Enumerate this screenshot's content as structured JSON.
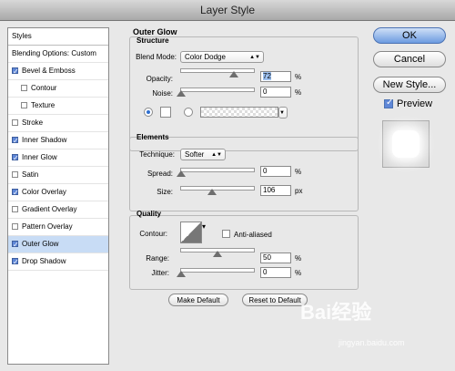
{
  "window": {
    "title": "Layer Style"
  },
  "styles_panel": {
    "header": "Styles",
    "items": [
      {
        "label": "Blending Options: Custom",
        "checkbox": false,
        "checked": false,
        "selected": false,
        "indent": 0
      },
      {
        "label": "Bevel & Emboss",
        "checkbox": true,
        "checked": true,
        "selected": false,
        "indent": 0
      },
      {
        "label": "Contour",
        "checkbox": true,
        "checked": false,
        "selected": false,
        "indent": 1
      },
      {
        "label": "Texture",
        "checkbox": true,
        "checked": false,
        "selected": false,
        "indent": 1
      },
      {
        "label": "Stroke",
        "checkbox": true,
        "checked": false,
        "selected": false,
        "indent": 0
      },
      {
        "label": "Inner Shadow",
        "checkbox": true,
        "checked": true,
        "selected": false,
        "indent": 0
      },
      {
        "label": "Inner Glow",
        "checkbox": true,
        "checked": true,
        "selected": false,
        "indent": 0
      },
      {
        "label": "Satin",
        "checkbox": true,
        "checked": false,
        "selected": false,
        "indent": 0
      },
      {
        "label": "Color Overlay",
        "checkbox": true,
        "checked": true,
        "selected": false,
        "indent": 0
      },
      {
        "label": "Gradient Overlay",
        "checkbox": true,
        "checked": false,
        "selected": false,
        "indent": 0
      },
      {
        "label": "Pattern Overlay",
        "checkbox": true,
        "checked": false,
        "selected": false,
        "indent": 0
      },
      {
        "label": "Outer Glow",
        "checkbox": true,
        "checked": true,
        "selected": true,
        "indent": 0
      },
      {
        "label": "Drop Shadow",
        "checkbox": true,
        "checked": true,
        "selected": false,
        "indent": 0
      }
    ]
  },
  "outer_glow": {
    "title": "Outer Glow",
    "structure": {
      "title": "Structure",
      "blend_mode_label": "Blend Mode:",
      "blend_mode_value": "Color Dodge",
      "opacity_label": "Opacity:",
      "opacity_value": "72",
      "opacity_fraction": 0.72,
      "noise_label": "Noise:",
      "noise_value": "0",
      "noise_fraction": 0.0,
      "unit_percent": "%"
    },
    "elements": {
      "title": "Elements",
      "technique_label": "Technique:",
      "technique_value": "Softer",
      "spread_label": "Spread:",
      "spread_value": "0",
      "spread_fraction": 0.0,
      "size_label": "Size:",
      "size_value": "106",
      "size_fraction": 0.42,
      "unit_percent": "%",
      "unit_px": "px"
    },
    "quality": {
      "title": "Quality",
      "contour_label": "Contour:",
      "anti_aliased_label": "Anti-aliased",
      "anti_aliased": false,
      "range_label": "Range:",
      "range_value": "50",
      "range_fraction": 0.5,
      "jitter_label": "Jitter:",
      "jitter_value": "0",
      "jitter_fraction": 0.0,
      "unit_percent": "%"
    },
    "make_default_label": "Make Default",
    "reset_default_label": "Reset to Default"
  },
  "right": {
    "ok_label": "OK",
    "cancel_label": "Cancel",
    "new_style_label": "New Style...",
    "preview_label": "Preview",
    "preview_checked": true
  },
  "watermark": {
    "brand": "Bai经验",
    "url": "jingyan.baidu.com"
  }
}
